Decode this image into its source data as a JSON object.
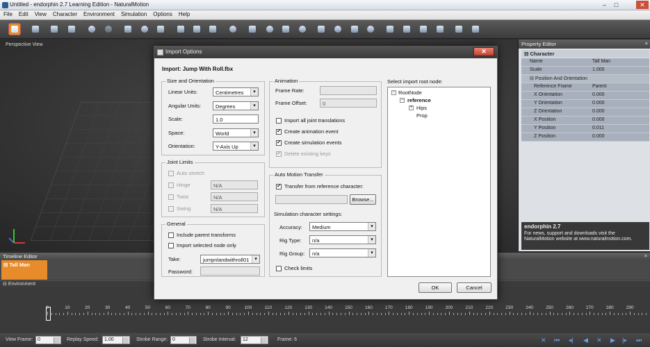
{
  "app": {
    "title": "Untitled - endorphin 2.7 Learning Edition - NaturalMotion",
    "window_buttons": [
      "–",
      "□",
      "✕"
    ]
  },
  "menu": [
    "File",
    "Edit",
    "View",
    "Character",
    "Environment",
    "Simulation",
    "Options",
    "Help"
  ],
  "viewport": {
    "label": "Perspective View"
  },
  "property_editor": {
    "title": "Property Editor",
    "close": "×",
    "section": "Character",
    "name_row": {
      "key": "Name",
      "value": "Tall Man"
    },
    "scale_row": {
      "key": "Scale",
      "value": "1.000"
    },
    "subsection": "Position And Orientation",
    "rows": [
      {
        "key": "Reference Frame",
        "value": "Parent"
      },
      {
        "key": "X Orientation",
        "value": "0.000"
      },
      {
        "key": "Y Orientation",
        "value": "0.000"
      },
      {
        "key": "Z Orientation",
        "value": "0.000"
      },
      {
        "key": "X Position",
        "value": "0.000"
      },
      {
        "key": "Y Position",
        "value": "0.011"
      },
      {
        "key": "Z Position",
        "value": "0.000"
      }
    ],
    "info_title": "endorphin 2.7",
    "info_text": "For news, support and downloads visit the NaturalMotion website at www.naturalmotion.com."
  },
  "timeline": {
    "title": "Timeline Editor",
    "close": "×",
    "track": "Tall Man",
    "environment": "Environment",
    "ticks": [
      "0",
      "10",
      "20",
      "30",
      "40",
      "50",
      "60",
      "70",
      "80",
      "90",
      "100",
      "110",
      "120",
      "130",
      "140",
      "150",
      "160",
      "170",
      "180",
      "190",
      "200",
      "210",
      "220",
      "230",
      "240",
      "250",
      "260",
      "270",
      "280",
      "290"
    ]
  },
  "status": {
    "view_frame_label": "View Frame:",
    "view_frame": "0",
    "replay_speed_label": "Replay Speed:",
    "replay_speed": "1.00",
    "strobe_range_label": "Strobe Range:",
    "strobe_range": "0",
    "strobe_interval_label": "Strobe Interval:",
    "strobe_interval": "12",
    "frame_label": "Frame: 6"
  },
  "dialog": {
    "title": "Import Options",
    "close": "✕",
    "heading": "Import: Jump With Roll.fbx",
    "size_orientation": {
      "title": "Size and Orientation",
      "linear_units_label": "Linear Units:",
      "linear_units": "Centimetres",
      "angular_units_label": "Angular Units:",
      "angular_units": "Degrees",
      "scale_label": "Scale:",
      "scale": "1.0",
      "space_label": "Space:",
      "space": "World",
      "orientation_label": "Orientation:",
      "orientation": "Y-Axis Up"
    },
    "joint_limits": {
      "title": "Joint Limits",
      "auto_stretch": "Auto stretch",
      "hinge": "Hinge",
      "hinge_value": "N/A",
      "twist": "Twist",
      "twist_value": "N/A",
      "swing": "Swing",
      "swing_value": "N/A"
    },
    "general": {
      "title": "General",
      "include_parent": "Include parent transforms",
      "import_selected": "Import selected node only",
      "take_label": "Take:",
      "take": "jumpnlandwithroll01",
      "password_label": "Password:",
      "password": ""
    },
    "animation": {
      "title": "Animation",
      "frame_rate_label": "Frame Rate:",
      "frame_rate": "",
      "frame_offset_label": "Frame Offset:",
      "frame_offset": "0",
      "import_joint_translations": "Import all joint translations",
      "create_animation_event": "Create animation event",
      "create_simulation_events": "Create simulation events",
      "delete_existing_keys": "Delete existing keys"
    },
    "auto_motion": {
      "title": "Auto Motion Transfer",
      "transfer_label": "Transfer from reference character:",
      "transfer_value": "",
      "browse": "Browse...",
      "sim_settings": "Simulation character settings:",
      "accuracy_label": "Accuracy:",
      "accuracy": "Medium",
      "rig_type_label": "Rig Type:",
      "rig_type": "n/a",
      "rig_group_label": "Rig Group:",
      "rig_group": "n/a",
      "check_limits": "Check limits"
    },
    "root_node": {
      "label": "Select import root node:",
      "root": "RootNode",
      "reference": "reference",
      "hips": "Hips",
      "prop": "Prop"
    },
    "ok": "OK",
    "cancel": "Cancel",
    "check_mark": "✔",
    "collapse": "–",
    "expand": "+"
  }
}
